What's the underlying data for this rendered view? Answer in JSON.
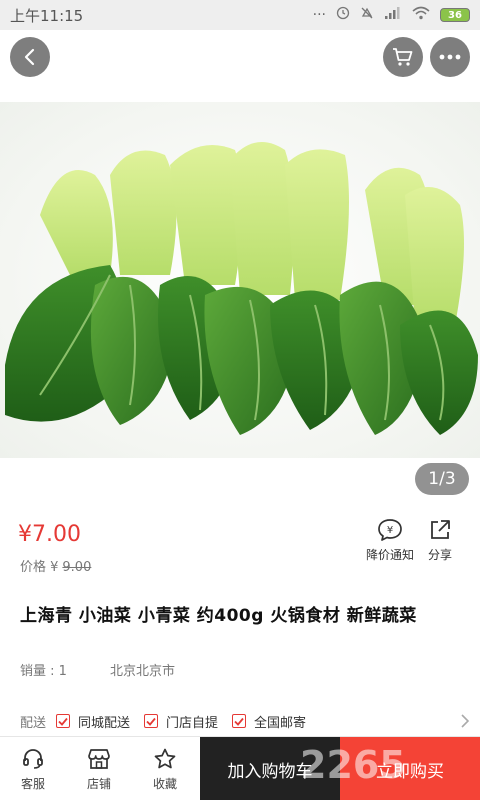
{
  "status_bar": {
    "time": "上午11:15",
    "battery": "36"
  },
  "gallery": {
    "current": "1",
    "total": "3",
    "image_icon": "bok-choy-product-image"
  },
  "product": {
    "price": "¥7.00",
    "orig_price_label": "价格 ¥",
    "orig_price": "9.00",
    "title": "上海青 小油菜 小青菜 约400g 火锅食材 新鲜蔬菜",
    "sales": "销量 : 1",
    "location": "北京北京市"
  },
  "actions": {
    "notify_label": "降价通知",
    "share_label": "分享"
  },
  "shipping": {
    "label": "配送",
    "options": [
      "同城配送",
      "门店自提",
      "全国邮寄"
    ]
  },
  "bottom_bar": {
    "service": "客服",
    "store": "店铺",
    "favorite": "收藏",
    "add_to_cart": "加入购物车",
    "buy_now": "立即购买",
    "watermark": "2265"
  },
  "colors": {
    "accent_red": "#e53935",
    "buy_red": "#f44336",
    "cart_dark": "#222222"
  }
}
